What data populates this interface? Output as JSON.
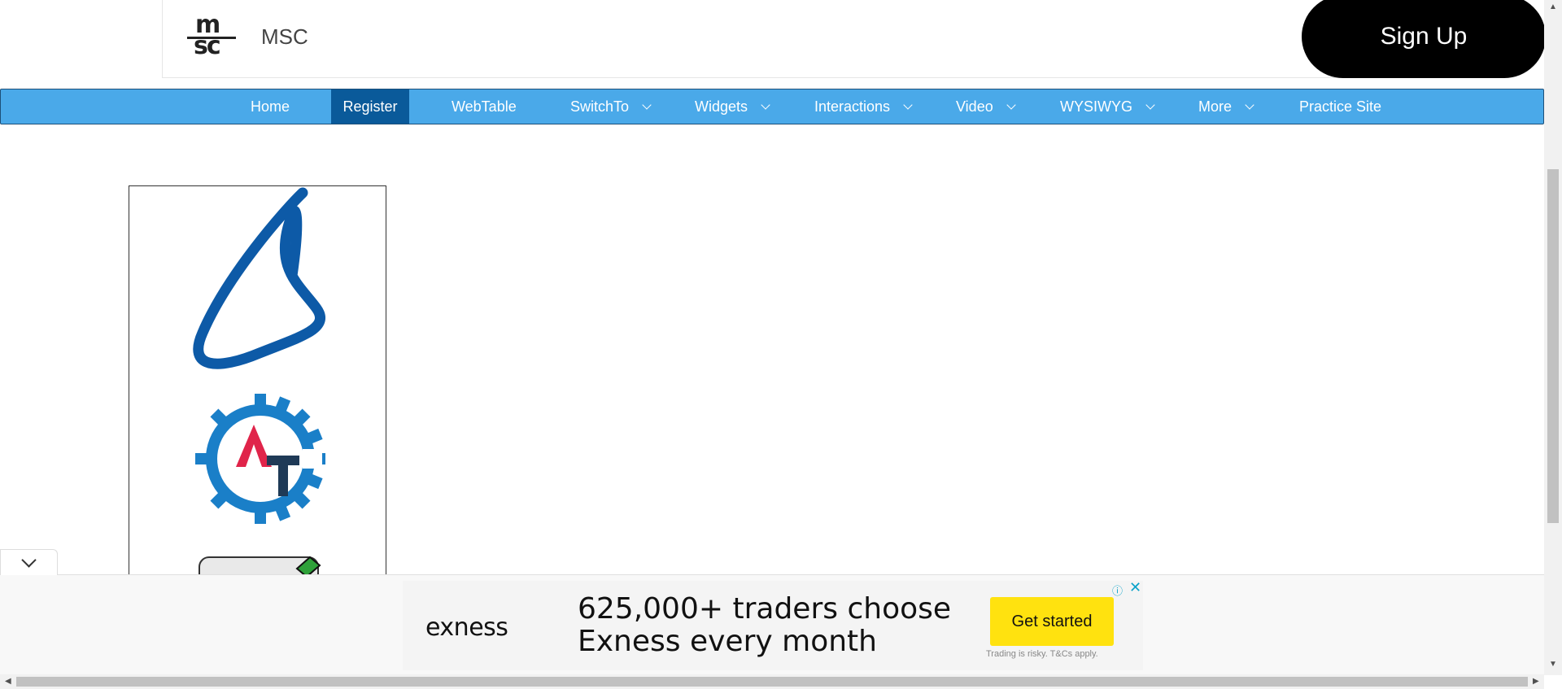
{
  "header": {
    "brand": "MSC",
    "logo_top": "m",
    "logo_bottom": "sc",
    "signup_label": "Sign Up"
  },
  "nav": [
    {
      "label": "Home",
      "has_menu": false,
      "active": false
    },
    {
      "label": "Register",
      "has_menu": false,
      "active": true
    },
    {
      "label": "WebTable",
      "has_menu": false,
      "active": false
    },
    {
      "label": "SwitchTo",
      "has_menu": true,
      "active": false
    },
    {
      "label": "Widgets",
      "has_menu": true,
      "active": false
    },
    {
      "label": "Interactions",
      "has_menu": true,
      "active": false
    },
    {
      "label": "Video",
      "has_menu": true,
      "active": false
    },
    {
      "label": "WYSIWYG",
      "has_menu": true,
      "active": false
    },
    {
      "label": "More",
      "has_menu": true,
      "active": false
    },
    {
      "label": "Practice Site",
      "has_menu": false,
      "active": false
    }
  ],
  "colors": {
    "nav_bg": "#4aa9e9",
    "nav_active": "#0a5a9a",
    "selenium_blue": "#0d5aa7",
    "gear_blue": "#1a7fc8",
    "at_red": "#e0244a",
    "at_navy": "#1f3a57",
    "cta_yellow": "#ffe20f"
  },
  "images": [
    "selenium-logo",
    "automation-gear-logo",
    "badge-partial"
  ],
  "ad": {
    "brand": "exness",
    "headline_line1": "625,000+ traders choose",
    "headline_line2": "Exness every month",
    "cta": "Get started",
    "disclaimer": "Trading is risky. T&Cs apply."
  }
}
